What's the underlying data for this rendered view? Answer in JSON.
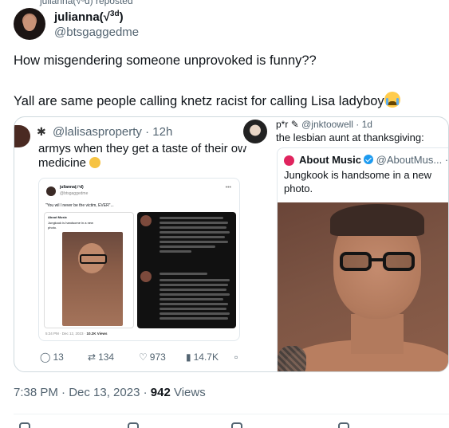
{
  "repost": {
    "label": "julianna(√³d) reposted"
  },
  "author": {
    "name": "julianna(√",
    "name_sup": "3d",
    "name_close": ")",
    "handle": "@btsgaggedme"
  },
  "tweet": {
    "line1": "How misgendering someone unprovoked is funny??",
    "line2": "Yall are same people calling knetz racist for calling Lisa ladyboy",
    "timestamp": "7:38 PM · Dec 13, 2023 · ",
    "views_count": "942",
    "views_label": " Views"
  },
  "left_embed": {
    "handle": "@lalisasproperty · 12h",
    "line1": "armys when they get a taste of their ow",
    "line2": "medicine",
    "screenshot": {
      "name": "julianna(√³d)",
      "handle": "@btsgaggedme",
      "quote": "\"You wil l never be the victim, EVER\"...",
      "inner_title": "About Music",
      "inner_text1": "Jungkook is handsome in a new",
      "inner_text2": "photo.",
      "footer_time": "5:24 PM · Dec 12, 2023 · ",
      "footer_views": "10.2K Views"
    },
    "actions": {
      "replies": "13",
      "reposts": "134",
      "likes": "973",
      "views": "14.7K"
    }
  },
  "right_embed": {
    "handle_prefix": "p*r",
    "handle": "@jnktoowell · 1d",
    "line1": "the lesbian aunt at thanksgiving:",
    "quoted": {
      "name": "About Music",
      "handle": "@AboutMus... · 1d",
      "line1": "Jungkook is handsome in a new",
      "line2": "photo."
    }
  },
  "colors": {
    "text_primary": "#0f1419",
    "text_secondary": "#536471",
    "border": "#cfd9de",
    "verified": "#1d9bf0"
  }
}
